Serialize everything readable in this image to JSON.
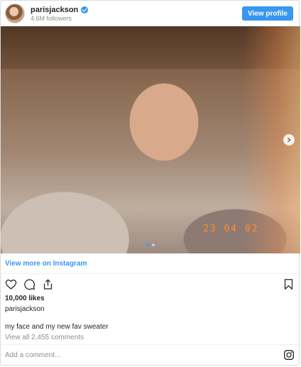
{
  "header": {
    "username": "parisjackson",
    "followers": "4.6M followers",
    "view_profile_label": "View profile"
  },
  "photo": {
    "timestamp": "23 04 02",
    "carousel_count": 2,
    "carousel_active": 1
  },
  "view_more_label": "View more on Instagram",
  "likes": "10,000 likes",
  "poster": "parisjackson",
  "caption": "my face and my new fav sweater",
  "comments_link": "View all 2,455 comments",
  "comment_placeholder": "Add a comment...",
  "icons": {
    "like": "heart-icon",
    "comment": "comment-icon",
    "share": "share-icon",
    "save": "bookmark-icon",
    "brand": "instagram-icon",
    "verified": "verified-badge-icon"
  },
  "colors": {
    "accent": "#3897f0",
    "timestamp": "#ff8c2a",
    "muted": "#8e8e8e",
    "text": "#262626"
  }
}
